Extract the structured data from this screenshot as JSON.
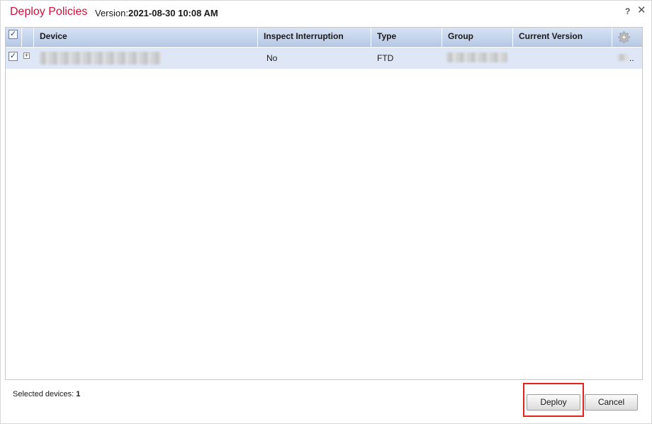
{
  "dialog": {
    "title": "Deploy Policies",
    "version_label": "Version:",
    "version_value": "2021-08-30 10:08 AM",
    "help_glyph": "?",
    "close_glyph": "✕"
  },
  "table": {
    "columns": [
      "Device",
      "Inspect Interruption",
      "Type",
      "Group",
      "Current Version"
    ],
    "select_all_checked": "✓",
    "rows": [
      {
        "checked": "✓",
        "expand_glyph": "+",
        "device": "",
        "inspect_interruption": "No",
        "type": "FTD",
        "group": "",
        "current_version": ".."
      }
    ]
  },
  "footer": {
    "selected_label": "Selected devices:",
    "selected_count": "1",
    "deploy_label": "Deploy",
    "cancel_label": "Cancel"
  },
  "colors": {
    "title": "#d0103a",
    "header_gradient_top": "#d8e3f3",
    "header_gradient_bottom": "#b7c9e6",
    "row_selected": "#dfe7f6",
    "highlight_border": "#e0231b"
  },
  "icons": [
    "help-icon",
    "close-icon",
    "expand-icon",
    "gear-icon"
  ]
}
